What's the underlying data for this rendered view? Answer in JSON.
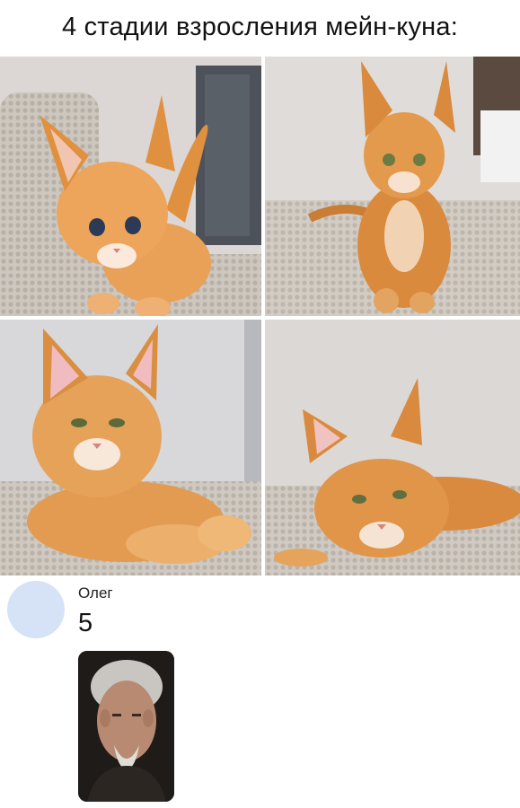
{
  "post": {
    "title": "4 стадии взросления мейн-куна:"
  },
  "photos": [
    {
      "icon": "kitten-photo-icon"
    },
    {
      "icon": "young-cat-photo-icon"
    },
    {
      "icon": "adult-cat-lying-photo-icon"
    },
    {
      "icon": "cat-lying-on-side-photo-icon"
    }
  ],
  "comment": {
    "author": "Олег",
    "text": "5",
    "avatar_color": "#d6e3f6",
    "attachment_icon": "man-portrait-photo-icon"
  },
  "colors": {
    "fur": "#e39546",
    "blanket": "#c9c3bb",
    "wall": "#d9d6d6"
  }
}
